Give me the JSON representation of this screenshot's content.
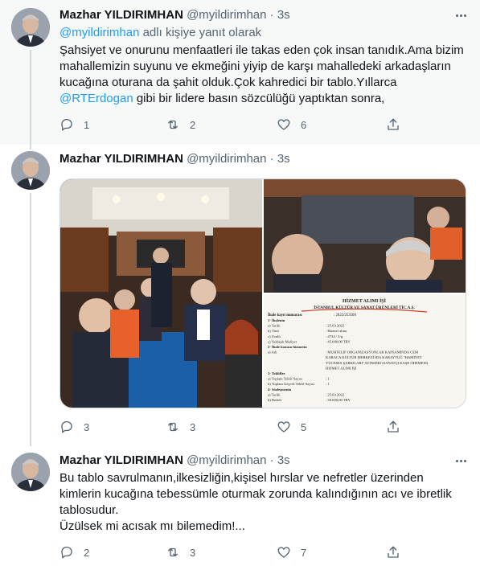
{
  "tweets": [
    {
      "name": "Mazhar YILDIRIMHAN",
      "handle": "@myildirimhan",
      "dot": "·",
      "time": "3s",
      "reply_prefix": "@myildirimhan",
      "reply_suffix": " adlı kişiye yanıt olarak",
      "lines": [
        "Şahsiyet ve onurunu menfaatleri ile takas eden çok insan tanıdık.Ama bizim",
        "mahallemizin suyunu ve ekmeğini yiyip de karşı mahalledeki arkadaşların",
        "kucağına oturana da şahit olduk.Çok kahredici bir tablo.Yıllarca"
      ],
      "last_line_mention": "@RTErdogan",
      "last_line_rest": " gibi bir lidere basın sözcülüğü yaptıktan sonra,",
      "replies": "1",
      "retweets": "2",
      "likes": "6"
    },
    {
      "name": "Mazhar YILDIRIMHAN",
      "handle": "@myildirimhan",
      "dot": "·",
      "time": "3s",
      "replies": "3",
      "retweets": "3",
      "likes": "5",
      "document": {
        "heading1": "HİZMET ALIMI İŞİ",
        "heading2": "İSTANBUL KÜLTÜR VE SANAT ÜRÜNLERİ TİC.A.Ş.",
        "ihale_label": "İhale kayıt numarası",
        "ihale_value": ": 2022/253500",
        "rows": [
          {
            "label": "1- İhalenin",
            "value": ""
          },
          {
            "label": "a) Tarihi",
            "value": ": 25.03.2022"
          },
          {
            "label": "b) Türü",
            "value": ": Hizmet alımı"
          },
          {
            "label": "c) Usulü",
            "value": ": 4734 / 3-g"
          },
          {
            "label": "ç) Yaklaşık Maliyet",
            "value": ": 45.000,00 TRY"
          },
          {
            "label": "2- İhale konusu hizmetin",
            "value": ""
          },
          {
            "label": "a) Adı",
            "value": ": MUHTELİF ORGANİZASYONLAR KAPSAMINDA CEM"
          },
          {
            "label": "",
            "value": "KARACA KÜLTÜR MERKEZİ İDA KARAYTUĞ \"HAMİYET"
          },
          {
            "label": "",
            "value": "YÜCESES ŞARKILARI\" KONSERİ (SANATÇI KAŞE ÖDEMESİ)"
          },
          {
            "label": "",
            "value": "HİZMET ALIMI İŞİ"
          },
          {
            "label": "3- Teklifler",
            "value": ""
          },
          {
            "label": "a) Toplam Teklif Sayısı",
            "value": ": 1"
          },
          {
            "label": "b) Toplam Geçerli Teklif Sayısı",
            "value": ": 1"
          },
          {
            "label": "4- Sözleşmenin",
            "value": ""
          },
          {
            "label": "a) Tarihi",
            "value": ": 25.03.2022"
          },
          {
            "label": "b) Bedeli",
            "value": ": 30.000,00 TRY"
          }
        ]
      }
    },
    {
      "name": "Mazhar YILDIRIMHAN",
      "handle": "@myildirimhan",
      "dot": "·",
      "time": "3s",
      "lines": [
        "Bu tablo savrulmanın,ilkesizliğin,kişisel hırslar ve nefretler üzerinden",
        "kimlerin kucağına tebessümle oturmak zorunda kalındığının acı ve ibretlik",
        "tablosudur.",
        "Üzülsek mi acısak mı bilemedim!..."
      ],
      "replies": "2",
      "retweets": "3",
      "likes": "7"
    }
  ],
  "colors": {
    "link": "#1d9bf0",
    "secondary": "#536471",
    "text": "#0f1419",
    "thread_line": "#cfd9de",
    "highlight_bg": "#f7f9f9"
  },
  "icons": [
    "reply-icon",
    "retweet-icon",
    "like-icon",
    "share-icon",
    "more-icon"
  ]
}
